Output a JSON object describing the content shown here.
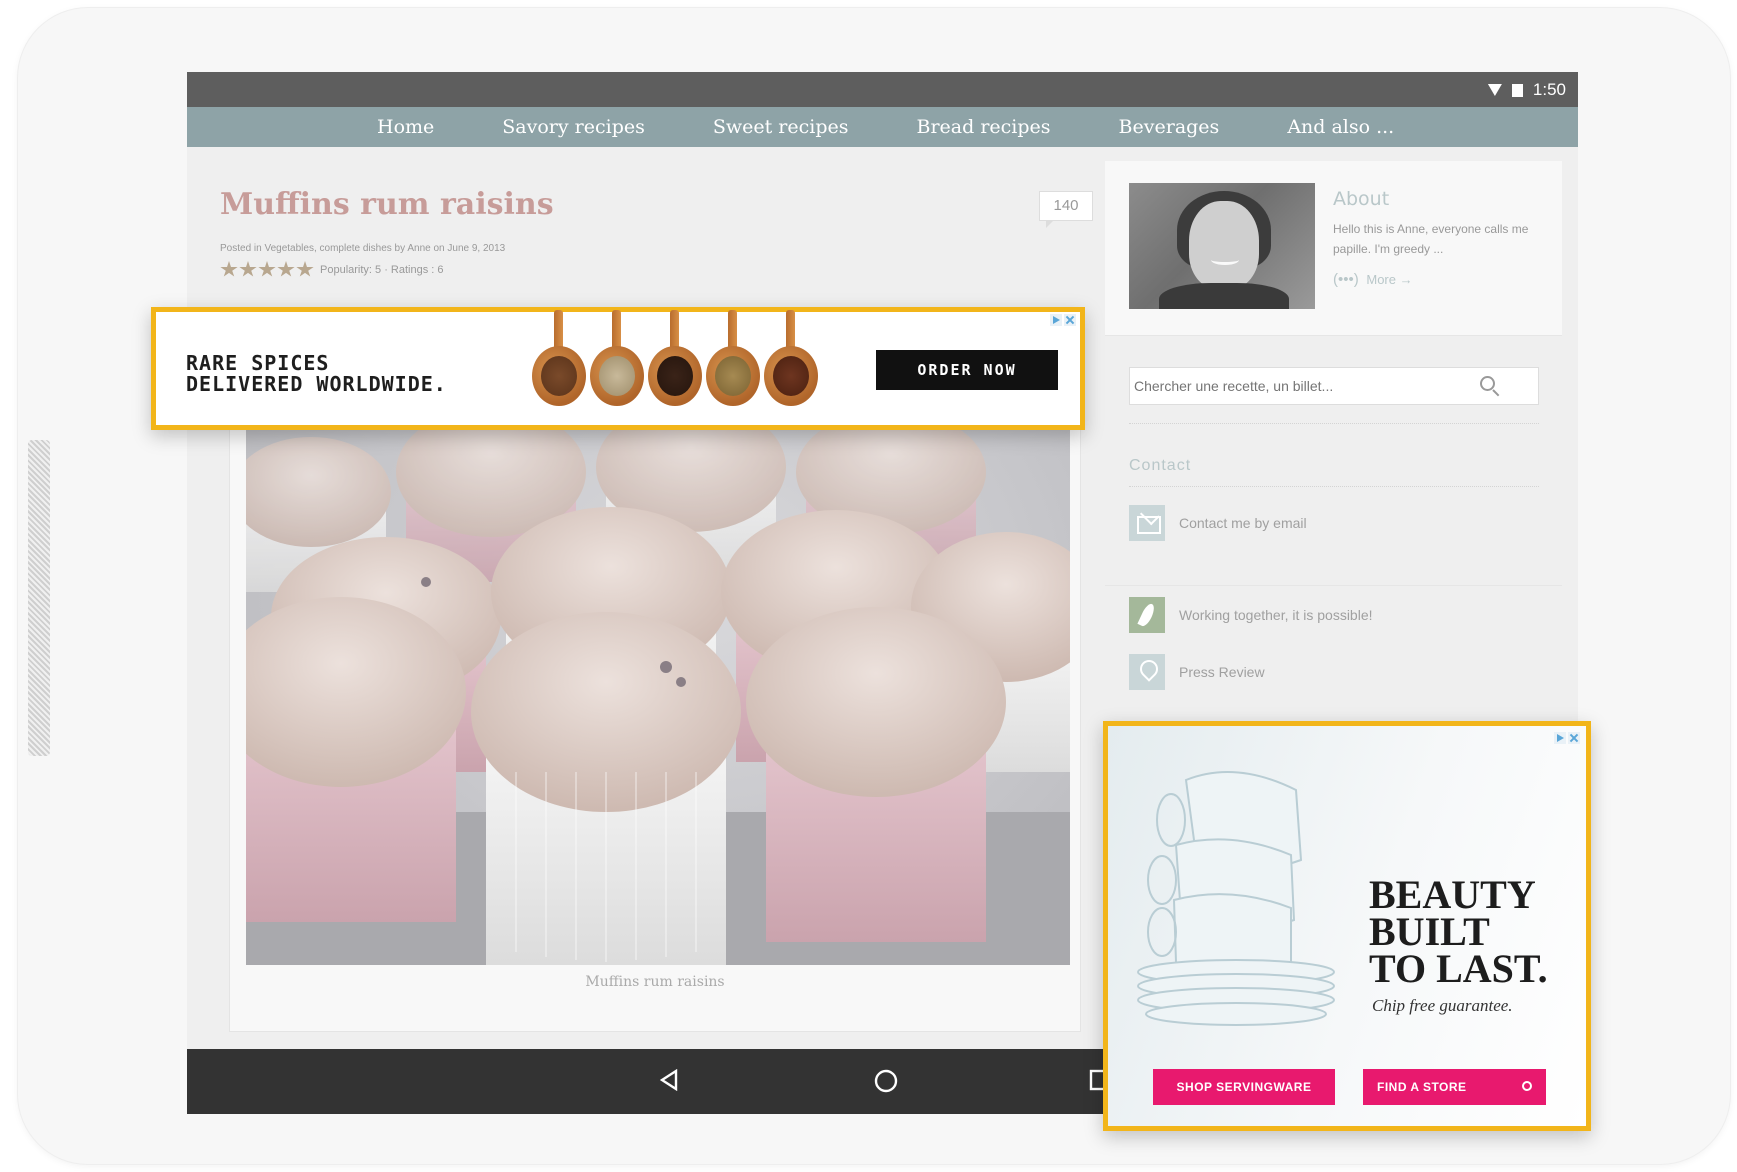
{
  "status_bar": {
    "time": "1:50"
  },
  "nav": {
    "items": [
      "Home",
      "Savory recipes",
      "Sweet recipes",
      "Bread recipes",
      "Beverages",
      "And also ..."
    ]
  },
  "post": {
    "title": "Muffins rum raisins",
    "comment_count": "140",
    "meta": "Posted in Vegetables, complete dishes by Anne on June 9, 2013",
    "rating": 5,
    "rating_text": "Popularity: 5 · Ratings : 6",
    "caption": "Muffins rum raisins"
  },
  "sidebar": {
    "about_title": "About",
    "about_text": "Hello this is Anne, everyone calls me papille. I'm greedy ...",
    "about_more": "More →",
    "search_placeholder": "Chercher une recette, un billet...",
    "contact_title": "Contact",
    "contact_link": "Contact me by email",
    "links": [
      "Working together, it is possible!",
      "Press Review"
    ]
  },
  "ad_banner": {
    "headline": "RARE SPICES\nDELIVERED WORLDWIDE.",
    "button": "ORDER NOW",
    "colors": {
      "border": "#f2b51a",
      "button": "#111111"
    }
  },
  "ad_box": {
    "headline": "BEAUTY\nBUILT\nTO LAST.",
    "subline": "Chip free guarantee.",
    "button_shop": "SHOP SERVINGWARE",
    "button_store": "FIND A STORE",
    "colors": {
      "border": "#f2b51a",
      "button": "#e8196e"
    }
  },
  "colors": {
    "nav_bar": "#8ea3a7",
    "status_bar": "#5e5e5e",
    "title": "#c79c99",
    "android_nav": "#333333"
  }
}
